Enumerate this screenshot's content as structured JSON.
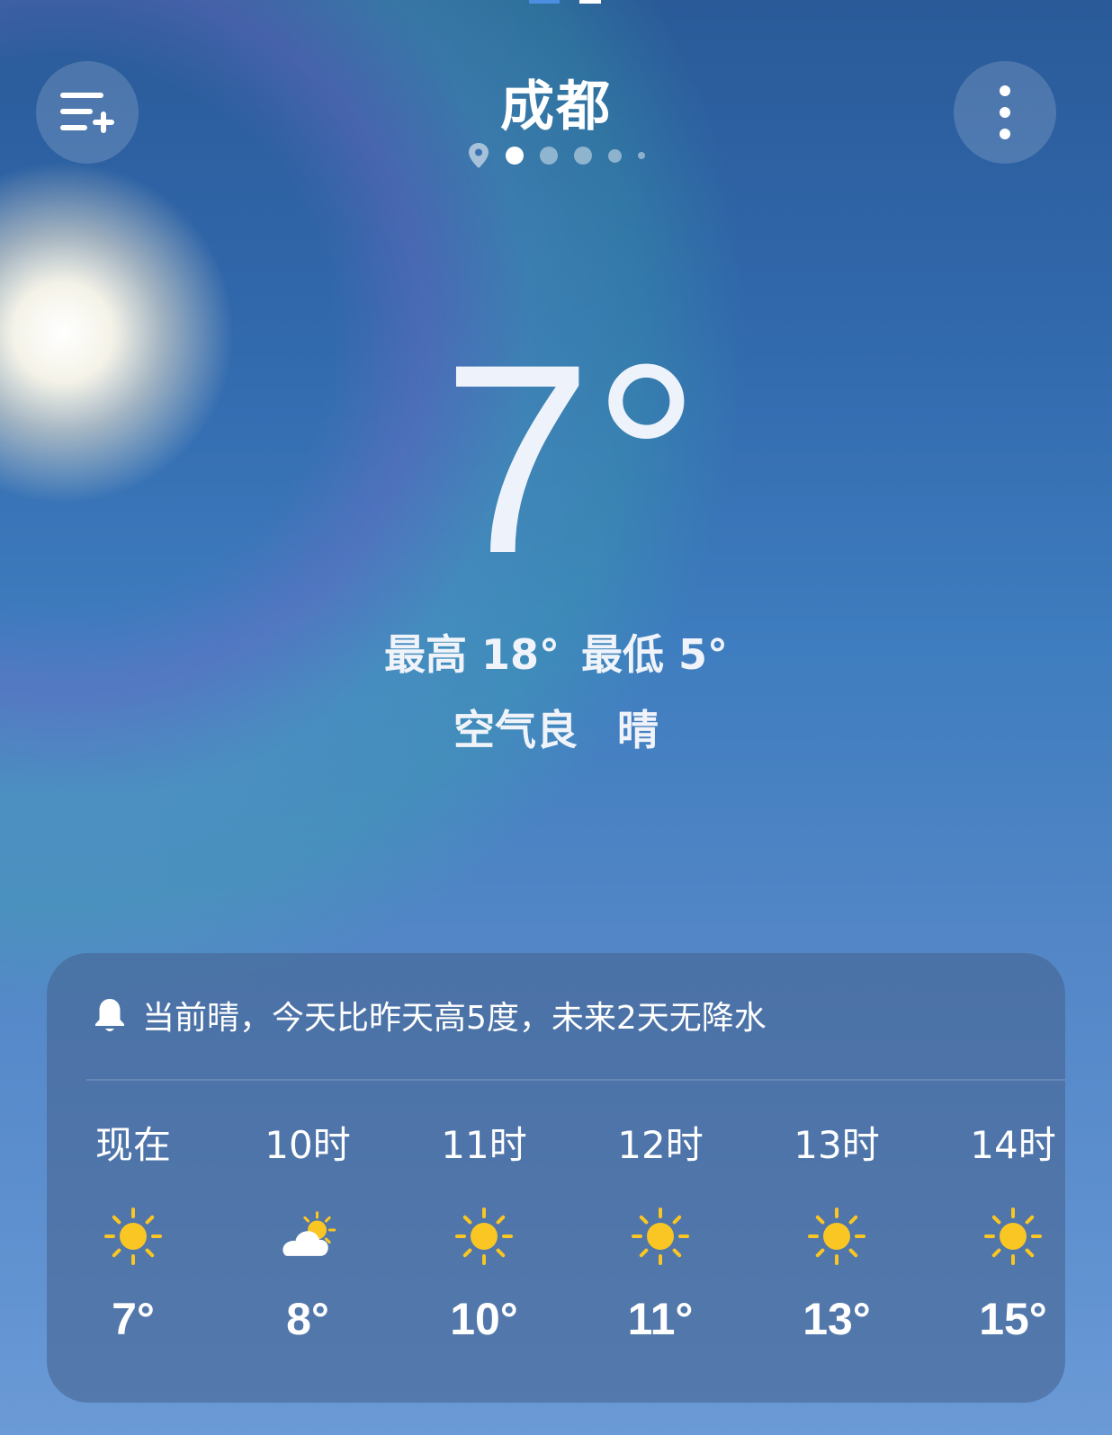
{
  "header": {
    "city": "成都",
    "add_city_icon": "list-add-icon",
    "more_icon": "more-vertical-icon",
    "location_icon": "location-pin-icon",
    "page_count": 5,
    "active_page": 1
  },
  "current": {
    "temperature": "7°",
    "high_low": {
      "high_label": "最高 18°",
      "low_label": "最低 5°"
    },
    "air_quality": "空气良",
    "condition": "晴"
  },
  "card": {
    "alert_icon": "bell-icon",
    "alert_text": "当前晴，今天比昨天高5度，未来2天无降水",
    "hourly": [
      {
        "time": "现在",
        "icon": "sun-icon",
        "temp": "7°"
      },
      {
        "time": "10时",
        "icon": "partly-cloudy-icon",
        "temp": "8°"
      },
      {
        "time": "11时",
        "icon": "sun-icon",
        "temp": "10°"
      },
      {
        "time": "12时",
        "icon": "sun-icon",
        "temp": "11°"
      },
      {
        "time": "13时",
        "icon": "sun-icon",
        "temp": "13°"
      },
      {
        "time": "14时",
        "icon": "sun-icon",
        "temp": "15°"
      }
    ]
  },
  "colors": {
    "sun_yellow": "#f9c623",
    "cloud_white": "#ffffff",
    "card_bg": "rgba(70,100,145,0.6)"
  }
}
